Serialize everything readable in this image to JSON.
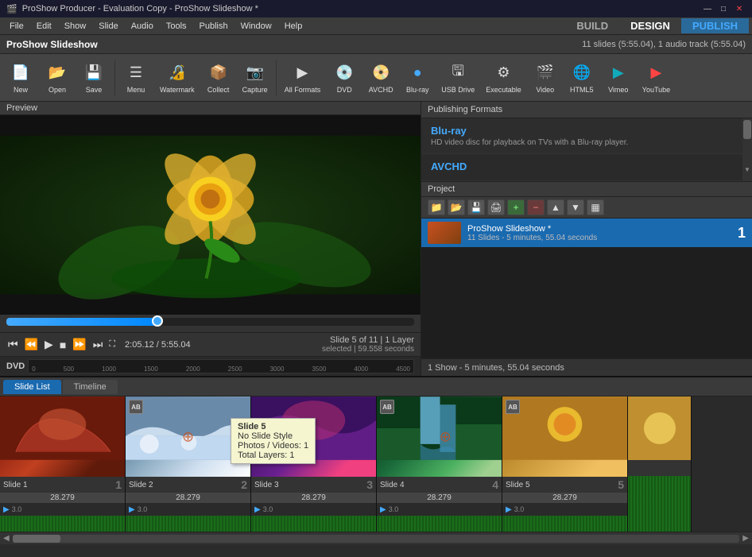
{
  "titlebar": {
    "title": "ProShow Producer - Evaluation Copy - ProShow Slideshow *",
    "minimize": "—",
    "maximize": "□",
    "close": "✕"
  },
  "appname": "ProShow Slideshow",
  "slide_count_info": "11 slides (5:55.04), 1 audio track (5:55.04)",
  "menubar": {
    "items": [
      "File",
      "Edit",
      "Show",
      "Slide",
      "Audio",
      "Tools",
      "Publish",
      "Window",
      "Help"
    ],
    "build_label": "BUILD",
    "design_label": "DESIGN",
    "publish_label": "PUBLISH"
  },
  "toolbar": {
    "buttons": [
      {
        "label": "New",
        "icon": "🆕"
      },
      {
        "label": "Open",
        "icon": "📂"
      },
      {
        "label": "Save",
        "icon": "💾"
      },
      {
        "label": "Menu",
        "icon": "☰"
      },
      {
        "label": "Watermark",
        "icon": "🔒"
      },
      {
        "label": "Collect",
        "icon": "📦"
      },
      {
        "label": "Capture",
        "icon": "📷"
      },
      {
        "label": "All Formats",
        "icon": "▶"
      },
      {
        "label": "DVD",
        "icon": "💿"
      },
      {
        "label": "AVCHD",
        "icon": "📀"
      },
      {
        "label": "Blu-ray",
        "icon": "🔵"
      },
      {
        "label": "USB Drive",
        "icon": "🖫"
      },
      {
        "label": "Executable",
        "icon": "⚙"
      },
      {
        "label": "Video",
        "icon": "🎬"
      },
      {
        "label": "HTML5",
        "icon": "🌐"
      },
      {
        "label": "Vimeo",
        "icon": "▶"
      },
      {
        "label": "YouTube",
        "icon": "▶"
      }
    ]
  },
  "preview": {
    "label": "Preview"
  },
  "playback": {
    "timecode": "2:05.12 / 5:55.04",
    "slide_info": "Slide 5 of 11  |  1 Layer",
    "slide_detail": "selected  |  59.558 seconds"
  },
  "dvd": {
    "label": "DVD",
    "marks": [
      "0",
      "500",
      "1000",
      "1500",
      "2000",
      "2500",
      "3000",
      "3500",
      "4000",
      "4500"
    ]
  },
  "publishing": {
    "title": "Publishing Formats",
    "formats": [
      {
        "name": "Blu-ray",
        "desc": "HD video disc for playback on TVs with a Blu-ray player.",
        "active": false
      },
      {
        "name": "AVCHD",
        "desc": "",
        "active": false
      }
    ]
  },
  "project": {
    "label": "Project",
    "show_info": "1 Show - 5 minutes, 55.04 seconds",
    "item": {
      "name": "ProShow Slideshow *",
      "sub": "11 Slides - 5 minutes, 55.04 seconds",
      "num": "1"
    }
  },
  "tabs": {
    "slide_list": "Slide List",
    "timeline": "Timeline"
  },
  "slides": [
    {
      "name": "Slide 1",
      "num": "1",
      "time": "28.279",
      "play_time": "3.0",
      "thumb_class": "thumb-red",
      "has_ab": false
    },
    {
      "name": "Slide 2",
      "num": "2",
      "time": "28.279",
      "play_time": "3.0",
      "thumb_class": "thumb-snow",
      "has_ab": true
    },
    {
      "name": "Slide 3",
      "num": "3",
      "time": "28.279",
      "play_time": "3.0",
      "thumb_class": "thumb-purple",
      "has_ab": false
    },
    {
      "name": "Slide 4",
      "num": "4",
      "time": "28.279",
      "play_time": "3.0",
      "thumb_class": "thumb-falls",
      "has_ab": true
    },
    {
      "name": "Slide 5",
      "num": "5",
      "time": "28.279",
      "play_time": "3.0",
      "thumb_class": "thumb-yellow",
      "has_ab": false
    }
  ],
  "tooltip": {
    "title": "Slide 5",
    "line1": "No Slide Style",
    "line2": "Photos / Videos: 1",
    "line3": "Total Layers: 1"
  },
  "scrollbar": {
    "label": "◀",
    "label2": "▶"
  }
}
